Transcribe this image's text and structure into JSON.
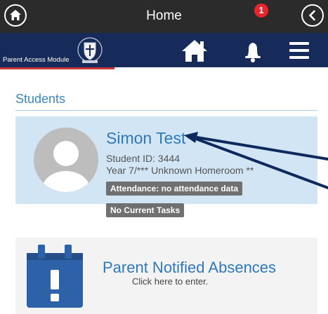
{
  "header": {
    "title": "Home",
    "home_icon": "home-circle-icon",
    "back_icon": "back-circle-icon"
  },
  "nav": {
    "module_label": "Parent Access Module",
    "crest_icon": "school-crest-icon",
    "home_icon": "home-icon",
    "bell_icon": "bell-icon",
    "notification_count": "1",
    "menu_icon": "hamburger-menu-icon",
    "colors": {
      "bar": "#172b5a",
      "accent": "#c8323a",
      "badge": "#e8242c"
    }
  },
  "students": {
    "heading": "Students",
    "items": [
      {
        "name": "Simon Test",
        "id_text": "Student ID: 3444",
        "year_text": "Year 7/*** Unknown Homeroom **",
        "attendance_badge": "Attendance: no attendance data",
        "tasks_badge": "No Current Tasks"
      }
    ]
  },
  "absences": {
    "title": "Parent Notified Absences",
    "subtitle": "Click here to enter.",
    "icon": "calendar-alert-icon"
  }
}
